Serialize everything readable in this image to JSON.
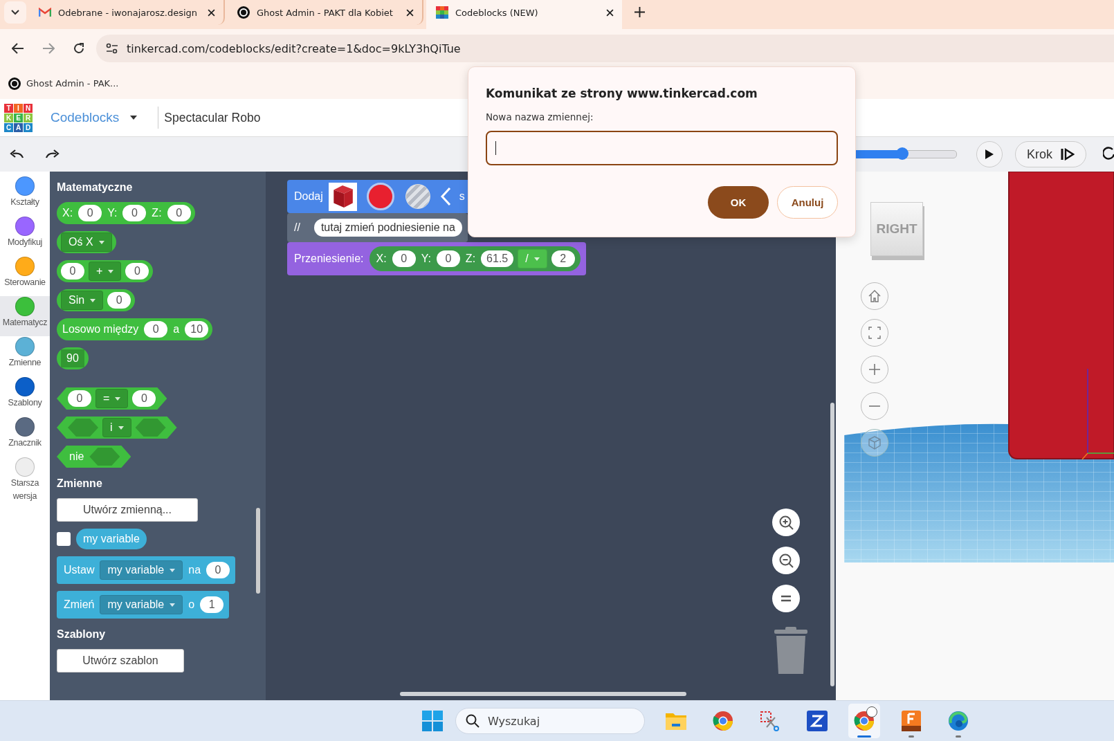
{
  "browser": {
    "tabs": [
      {
        "title": "Odebrane - iwonajarosz.design",
        "kind": "gmail",
        "selected": false
      },
      {
        "title": "Ghost Admin - PAKT dla Kobiet",
        "kind": "ghost",
        "selected": false
      },
      {
        "title": "Codeblocks (NEW)",
        "kind": "tinkercad",
        "selected": true
      }
    ],
    "url": "tinkercad.com/codeblocks/edit?create=1&doc=9kLY3hQiTue",
    "bookmarks": [
      {
        "title": "Ghost Admin - PAK...",
        "kind": "ghost"
      }
    ]
  },
  "header": {
    "logo": [
      {
        "letter": "T",
        "color": "#e8313a"
      },
      {
        "letter": "I",
        "color": "#f26522"
      },
      {
        "letter": "N",
        "color": "#e8313a"
      },
      {
        "letter": "K",
        "color": "#8dc63f"
      },
      {
        "letter": "E",
        "color": "#38b54a"
      },
      {
        "letter": "R",
        "color": "#8dc63f"
      },
      {
        "letter": "C",
        "color": "#1e88c8"
      },
      {
        "letter": "A",
        "color": "#2b5fa8"
      },
      {
        "letter": "D",
        "color": "#1e88c8"
      }
    ],
    "app": "Codeblocks",
    "design": "Spectacular Robo"
  },
  "toolbar": {
    "speed": {
      "level": 0.73
    },
    "step": "Krok"
  },
  "categories": [
    {
      "name": "Kształty",
      "color": "#4c97ff",
      "selected": false
    },
    {
      "name": "Modyfikuj",
      "color": "#9966ff",
      "selected": false
    },
    {
      "name": "Sterowanie",
      "color": "#ffab19",
      "selected": false
    },
    {
      "name": "Matematycz",
      "color": "#3cbf3c",
      "selected": true
    },
    {
      "name": "Zmienne",
      "color": "#5cb1d6",
      "selected": false
    },
    {
      "name": "Szablony",
      "color": "#0c5fc8",
      "selected": false
    },
    {
      "name": "Znacznik",
      "color": "#5a6a82",
      "selected": false
    },
    {
      "name": "Starsza wersja",
      "color": "#eeeeee",
      "selected": false
    }
  ],
  "palette": {
    "math_title": "Matematyczne",
    "math_blocks": [
      {
        "kind": "round",
        "color": "#3fbe3f",
        "parts": [
          {
            "kind": "label",
            "text": "X:"
          },
          {
            "kind": "value",
            "text": "0"
          },
          {
            "kind": "label",
            "text": "Y:"
          },
          {
            "kind": "value",
            "text": "0"
          },
          {
            "kind": "label",
            "text": "Z:"
          },
          {
            "kind": "value",
            "text": "0"
          }
        ]
      },
      {
        "kind": "round",
        "color": "#3fbe3f",
        "parts": [
          {
            "kind": "dropdown",
            "text": "Oś X"
          }
        ]
      },
      {
        "kind": "round",
        "color": "#3fbe3f",
        "parts": [
          {
            "kind": "value",
            "text": "0"
          },
          {
            "kind": "dropdown",
            "text": "+"
          },
          {
            "kind": "value",
            "text": "0"
          }
        ]
      },
      {
        "kind": "round",
        "color": "#3fbe3f",
        "parts": [
          {
            "kind": "dropdown",
            "text": "Sin"
          },
          {
            "kind": "value",
            "text": "0"
          }
        ]
      },
      {
        "kind": "round",
        "color": "#3fbe3f",
        "parts": [
          {
            "kind": "label",
            "text": "Losowo między"
          },
          {
            "kind": "value",
            "text": "0"
          },
          {
            "kind": "label",
            "text": "a"
          },
          {
            "kind": "value",
            "text": "10"
          }
        ]
      },
      {
        "kind": "round",
        "color": "#3fbe3f",
        "parts": [
          {
            "kind": "number",
            "text": "90"
          }
        ]
      },
      {
        "kind": "hex",
        "color": "#3fbe3f",
        "parts": [
          {
            "kind": "value",
            "text": "0"
          },
          {
            "kind": "dropdown",
            "text": "="
          },
          {
            "kind": "value",
            "text": "0"
          }
        ]
      },
      {
        "kind": "hex",
        "color": "#3fbe3f",
        "parts": [
          {
            "kind": "slot"
          },
          {
            "kind": "dropdown",
            "text": "i"
          },
          {
            "kind": "slot"
          }
        ]
      },
      {
        "kind": "hex",
        "color": "#3fbe3f",
        "parts": [
          {
            "kind": "label",
            "text": "nie"
          },
          {
            "kind": "slot"
          }
        ]
      }
    ],
    "vars_title": "Zmienne",
    "create_variable": "Utwórz zmienną...",
    "variable": {
      "name": "my variable",
      "checked": false
    },
    "var_blocks": [
      {
        "kind": "stack",
        "color": "#3db0d8",
        "parts": [
          {
            "kind": "label",
            "text": "Ustaw"
          },
          {
            "kind": "dropdown",
            "text": "my variable"
          },
          {
            "kind": "label",
            "text": "na"
          },
          {
            "kind": "value",
            "text": "0"
          }
        ]
      },
      {
        "kind": "stack",
        "color": "#3db0d8",
        "parts": [
          {
            "kind": "label",
            "text": "Zmień"
          },
          {
            "kind": "dropdown",
            "text": "my variable"
          },
          {
            "kind": "label",
            "text": "o"
          },
          {
            "kind": "value",
            "text": "1"
          }
        ]
      }
    ],
    "templates_title": "Szablony",
    "create_template": "Utwórz szablon"
  },
  "workspace": {
    "blocks": [
      {
        "kind": "stack",
        "color": "#4a86e8",
        "parts": [
          {
            "kind": "label",
            "text": "Dodaj"
          },
          {
            "kind": "cube"
          },
          {
            "kind": "color",
            "color": "#e8202f"
          },
          {
            "kind": "material"
          },
          {
            "kind": "chevron"
          },
          {
            "kind": "label",
            "text": "s"
          }
        ]
      },
      {
        "kind": "stack",
        "color": "#5f6b7d",
        "parts": [
          {
            "kind": "label",
            "text": "//"
          },
          {
            "kind": "comment",
            "text": "tutaj zmień podniesienie na"
          }
        ]
      },
      {
        "kind": "stack",
        "color": "#9463e0",
        "parts": [
          {
            "kind": "label",
            "text": "Przeniesienie:"
          },
          {
            "kind": "nested",
            "color": "#3c9a4a",
            "parts": [
              {
                "kind": "label",
                "text": "X:"
              },
              {
                "kind": "value",
                "text": "0"
              },
              {
                "kind": "label",
                "text": "Y:"
              },
              {
                "kind": "value",
                "text": "0"
              },
              {
                "kind": "label",
                "text": "Z:"
              },
              {
                "kind": "value",
                "text": "61.5"
              },
              {
                "kind": "dropdown",
                "text": "/"
              },
              {
                "kind": "value",
                "text": "2"
              }
            ]
          }
        ]
      }
    ]
  },
  "viewer": {
    "view_cube": "RIGHT"
  },
  "dialog": {
    "title": "Komunikat ze strony www.tinkercad.com",
    "label": "Nowa nazwa zmiennej:",
    "buttons": [
      {
        "label": "OK",
        "kind": "primary"
      },
      {
        "label": "Anuluj",
        "kind": "secondary"
      }
    ]
  },
  "taskbar": {
    "search": {
      "placeholder": "Wyszukaj"
    },
    "apps": [
      {
        "kind": "files",
        "selected": false,
        "running": false
      },
      {
        "kind": "chrome",
        "selected": false,
        "running": false
      },
      {
        "kind": "snip",
        "selected": false,
        "running": false
      },
      {
        "kind": "zapp",
        "selected": false,
        "running": false
      },
      {
        "kind": "chrome",
        "selected": true,
        "running": true
      },
      {
        "kind": "fusion",
        "selected": false,
        "running": true
      },
      {
        "kind": "edge",
        "selected": false,
        "running": true
      }
    ]
  }
}
